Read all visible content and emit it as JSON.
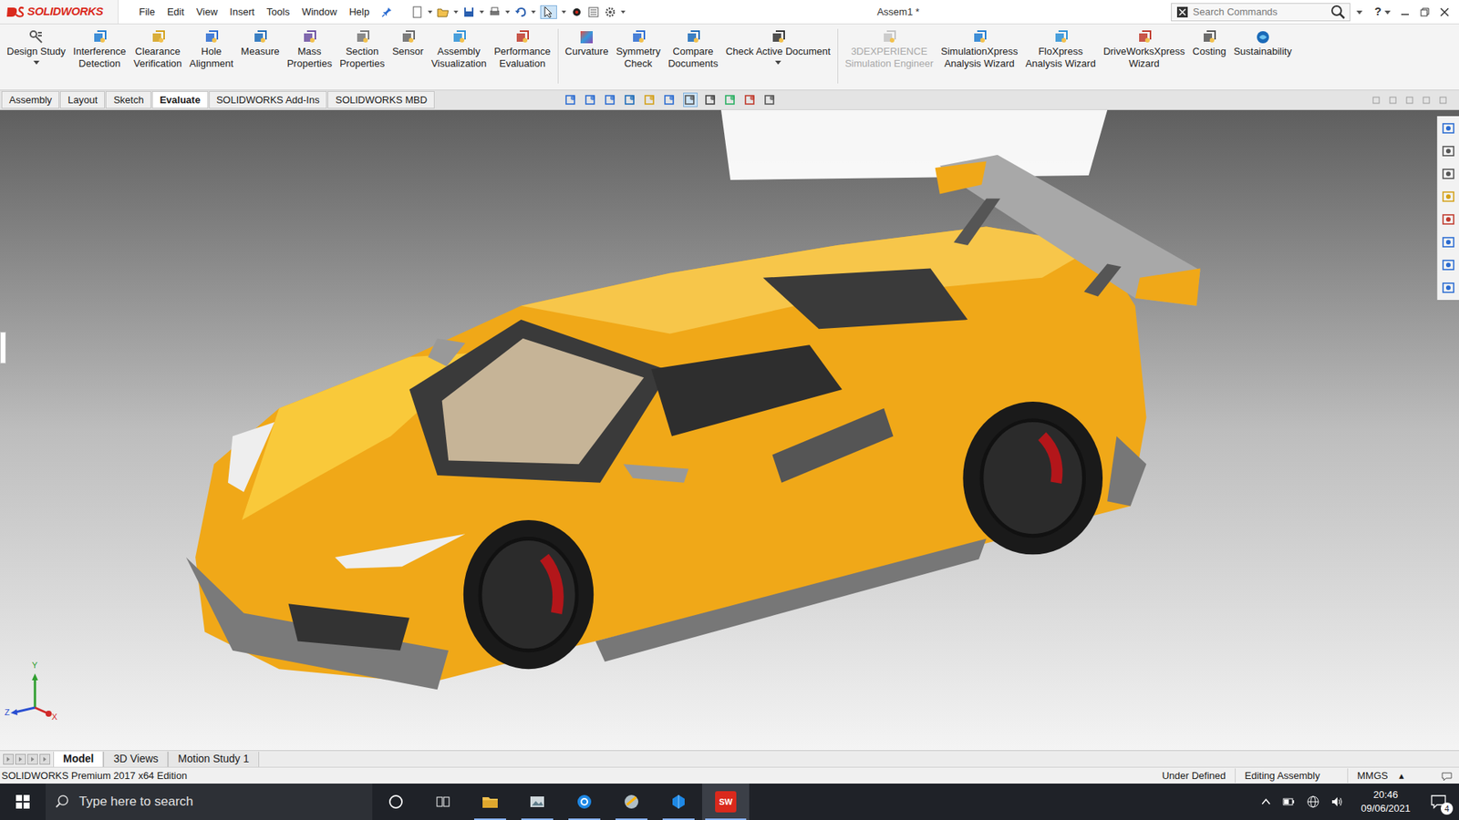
{
  "app": {
    "logo": "SOLIDWORKS",
    "title": "Assem1 *"
  },
  "menu": [
    "File",
    "Edit",
    "View",
    "Insert",
    "Tools",
    "Window",
    "Help"
  ],
  "search": {
    "placeholder": "Search Commands"
  },
  "help": "?",
  "ribbon": [
    {
      "lines": [
        "Design Study"
      ],
      "disabled": false
    },
    {
      "lines": [
        "Interference",
        "Detection"
      ],
      "disabled": false
    },
    {
      "lines": [
        "Clearance",
        "Verification"
      ],
      "disabled": false
    },
    {
      "lines": [
        "Hole",
        "Alignment"
      ],
      "disabled": false
    },
    {
      "lines": [
        "Measure"
      ],
      "disabled": false
    },
    {
      "lines": [
        "Mass",
        "Properties"
      ],
      "disabled": false
    },
    {
      "lines": [
        "Section",
        "Properties"
      ],
      "disabled": false
    },
    {
      "lines": [
        "Sensor"
      ],
      "disabled": false
    },
    {
      "lines": [
        "Assembly",
        "Visualization"
      ],
      "disabled": false
    },
    {
      "lines": [
        "Performance",
        "Evaluation"
      ],
      "disabled": false
    },
    {
      "lines": [
        "Curvature"
      ],
      "disabled": false
    },
    {
      "lines": [
        "Symmetry",
        "Check"
      ],
      "disabled": false
    },
    {
      "lines": [
        "Compare",
        "Documents"
      ],
      "disabled": false
    },
    {
      "lines": [
        "Check Active Document"
      ],
      "disabled": false
    },
    {
      "lines": [
        "3DEXPERIENCE",
        "Simulation Engineer"
      ],
      "disabled": true
    },
    {
      "lines": [
        "SimulationXpress",
        "Analysis Wizard"
      ],
      "disabled": false
    },
    {
      "lines": [
        "FloXpress",
        "Analysis Wizard"
      ],
      "disabled": false
    },
    {
      "lines": [
        "DriveWorksXpress",
        "Wizard"
      ],
      "disabled": false
    },
    {
      "lines": [
        "Costing"
      ],
      "disabled": false
    },
    {
      "lines": [
        "Sustainability"
      ],
      "disabled": false
    }
  ],
  "command_tabs": [
    {
      "label": "Assembly",
      "selected": false
    },
    {
      "label": "Layout",
      "selected": false
    },
    {
      "label": "Sketch",
      "selected": false
    },
    {
      "label": "Evaluate",
      "selected": true
    },
    {
      "label": "SOLIDWORKS Add-Ins",
      "selected": false
    },
    {
      "label": "SOLIDWORKS MBD",
      "selected": false
    }
  ],
  "triad": {
    "y": "Y",
    "z": "Z",
    "x": "X"
  },
  "bottom_tabs": [
    {
      "label": "Model",
      "selected": true
    },
    {
      "label": "3D Views",
      "selected": false
    },
    {
      "label": "Motion Study 1",
      "selected": false
    }
  ],
  "status_bar": {
    "edition": "SOLIDWORKS Premium 2017 x64 Edition",
    "state": "Under Defined",
    "mode": "Editing Assembly",
    "units": "MMGS",
    "units_arrow": "▴"
  },
  "taskbar": {
    "search_placeholder": "Type here to search",
    "sw_label": "SW",
    "time": "20:46",
    "date": "09/06/2021",
    "notifications": "4"
  }
}
